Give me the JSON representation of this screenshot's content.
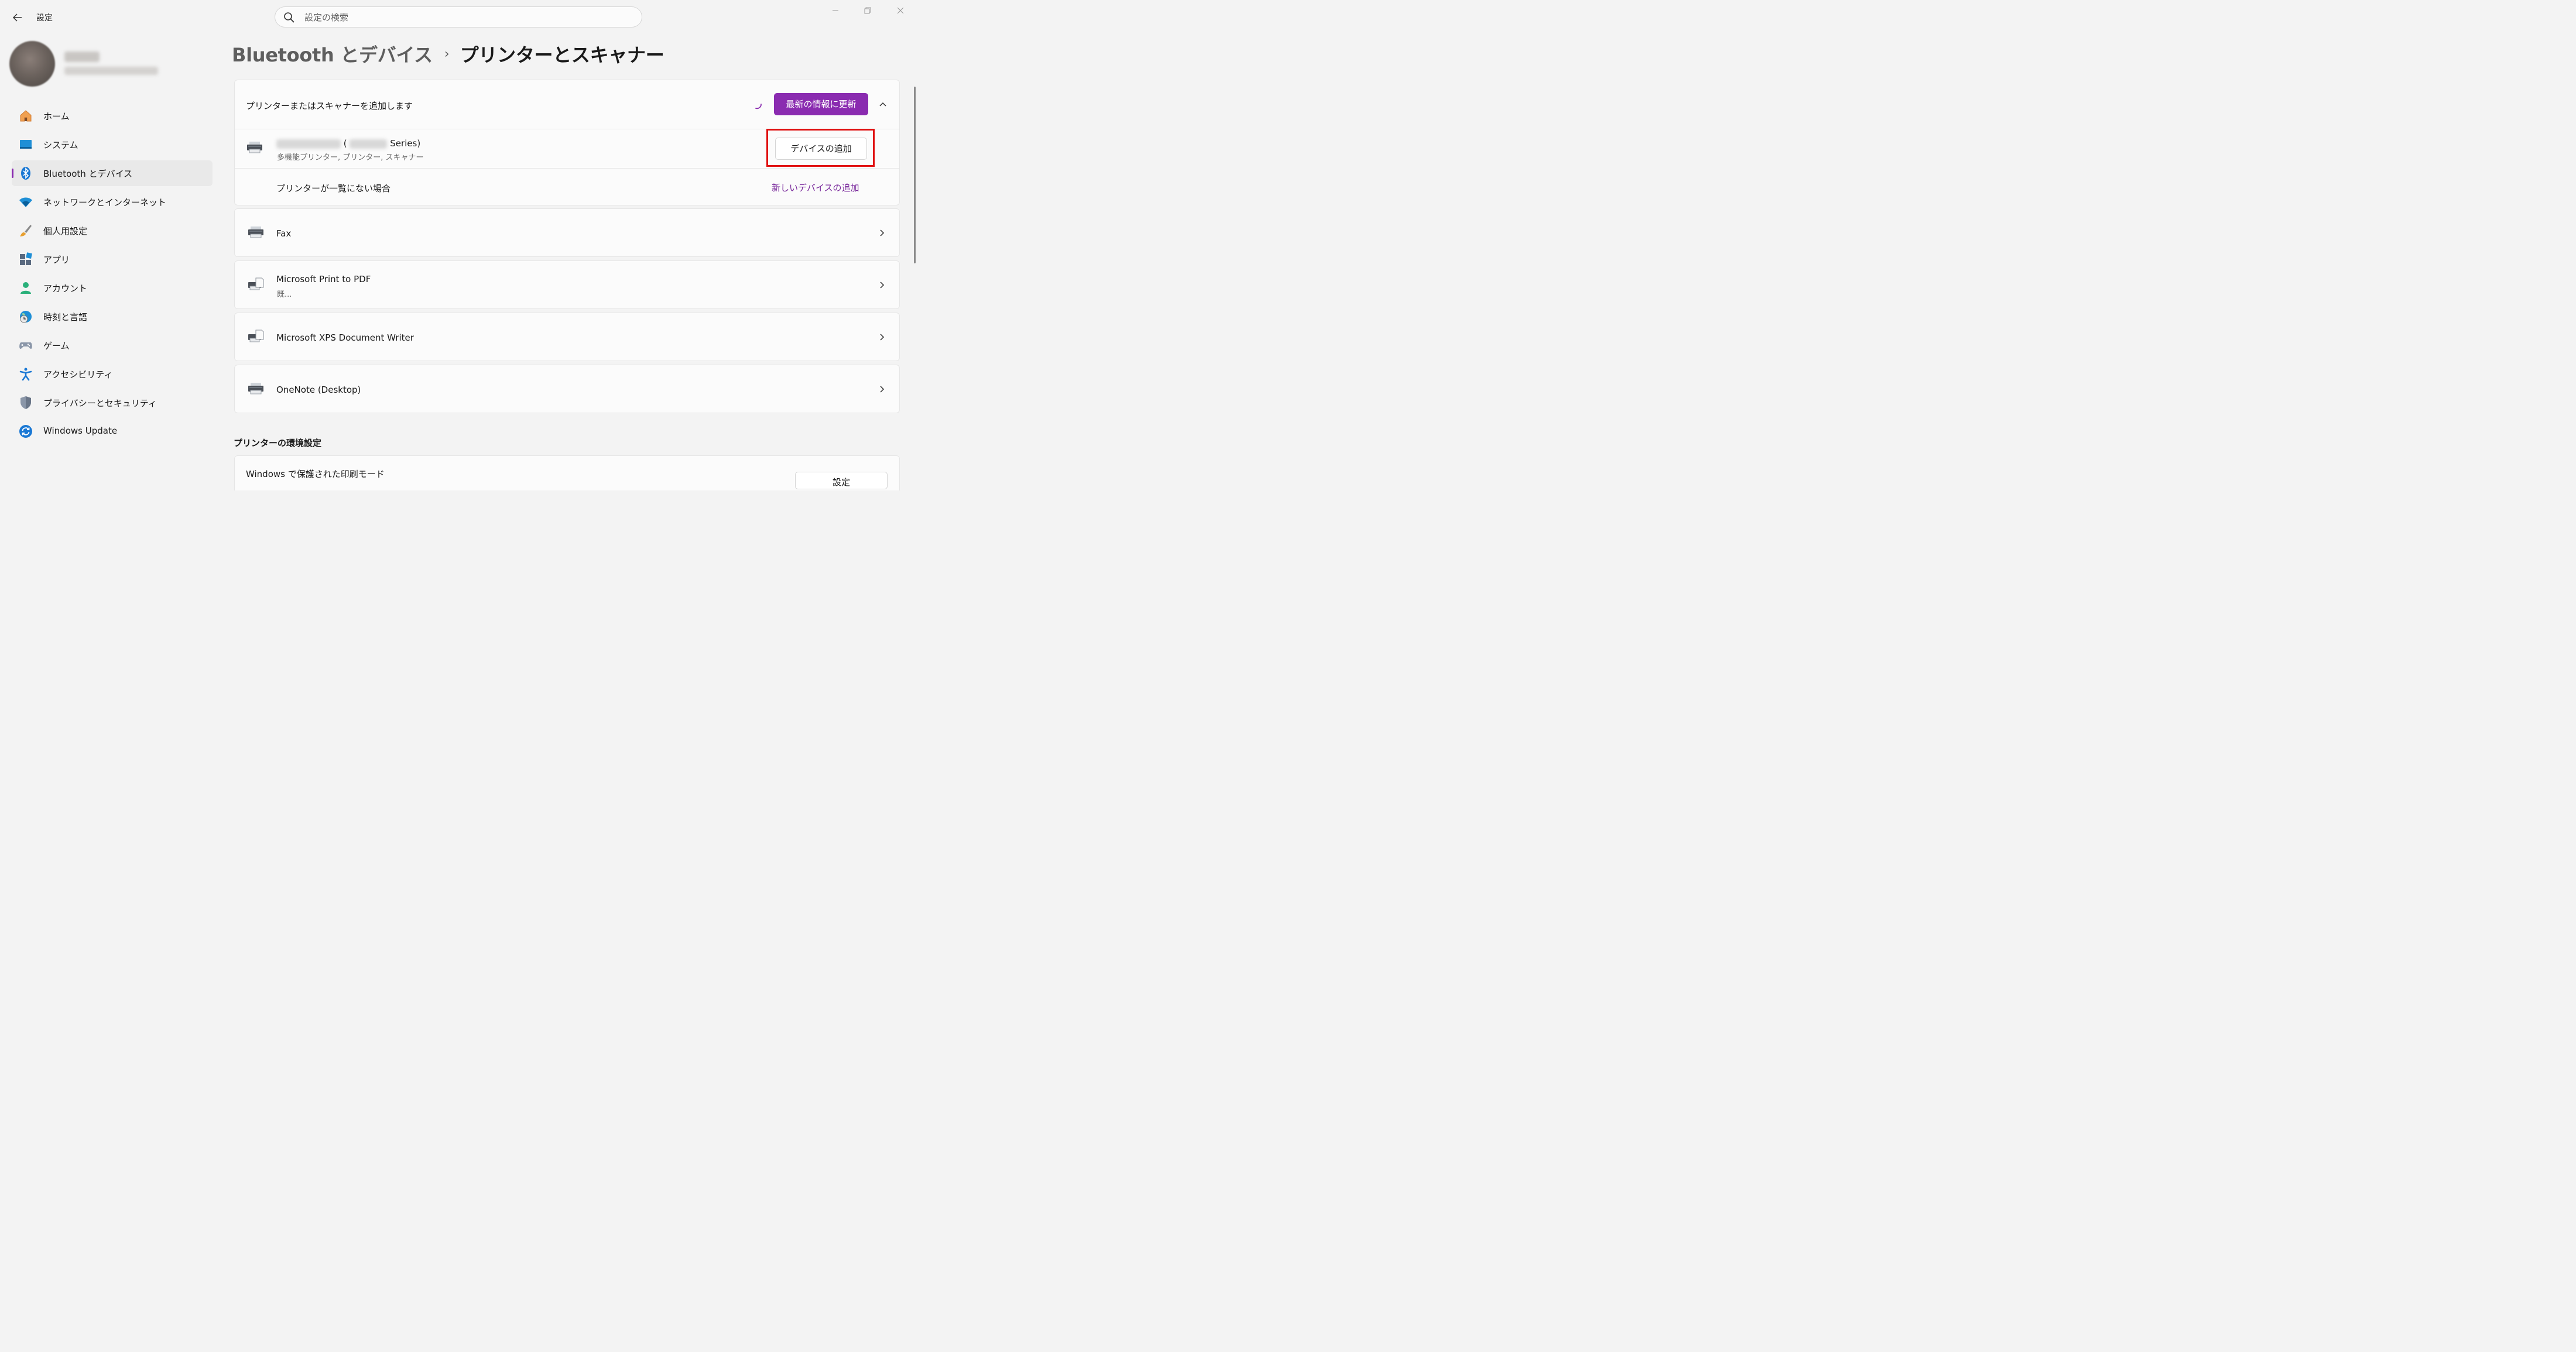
{
  "window": {
    "title": "設定",
    "controls": [
      "minimize-icon",
      "maximize-icon",
      "close-icon"
    ]
  },
  "search": {
    "placeholder": "設定の検索"
  },
  "sidebar": {
    "items": [
      {
        "label": "ホーム",
        "icon": "home-icon"
      },
      {
        "label": "システム",
        "icon": "system-icon"
      },
      {
        "label": "Bluetooth とデバイス",
        "icon": "bluetooth-icon",
        "active": true
      },
      {
        "label": "ネットワークとインターネット",
        "icon": "wifi-icon"
      },
      {
        "label": "個人用設定",
        "icon": "brush-icon"
      },
      {
        "label": "アプリ",
        "icon": "apps-icon"
      },
      {
        "label": "アカウント",
        "icon": "account-icon"
      },
      {
        "label": "時刻と言語",
        "icon": "time-language-icon"
      },
      {
        "label": "ゲーム",
        "icon": "gamepad-icon"
      },
      {
        "label": "アクセシビリティ",
        "icon": "accessibility-icon"
      },
      {
        "label": "プライバシーとセキュリティ",
        "icon": "shield-icon"
      },
      {
        "label": "Windows Update",
        "icon": "update-icon"
      }
    ]
  },
  "breadcrumb": {
    "parent": "Bluetooth とデバイス",
    "separator": "›",
    "current": "プリンターとスキャナー"
  },
  "add_panel": {
    "header_label": "プリンターまたはスキャナーを追加します",
    "refresh_button": "最新の情報に更新",
    "found_device": {
      "name_open": "(",
      "name_suffix": "Series)",
      "type": "多機能プリンター, プリンター, スキャナー",
      "add_button": "デバイスの追加"
    },
    "not_listed": {
      "label": "プリンターが一覧にない場合",
      "link": "新しいデバイスの追加"
    }
  },
  "printers": [
    {
      "name": "Fax",
      "status": ""
    },
    {
      "name": "Microsoft Print to PDF",
      "status": "既..."
    },
    {
      "name": "Microsoft XPS Document Writer",
      "status": ""
    },
    {
      "name": "OneNote (Desktop)",
      "status": ""
    }
  ],
  "preferences": {
    "heading": "プリンターの環境設定",
    "protected_mode_label": "Windows で保護された印刷モード",
    "protected_mode_button": "設定"
  },
  "colors": {
    "accent": "#8a2bb0",
    "link": "#7a2a9c",
    "highlight": "#e01010",
    "background": "#f3f3f3",
    "card": "#fbfbfb"
  }
}
